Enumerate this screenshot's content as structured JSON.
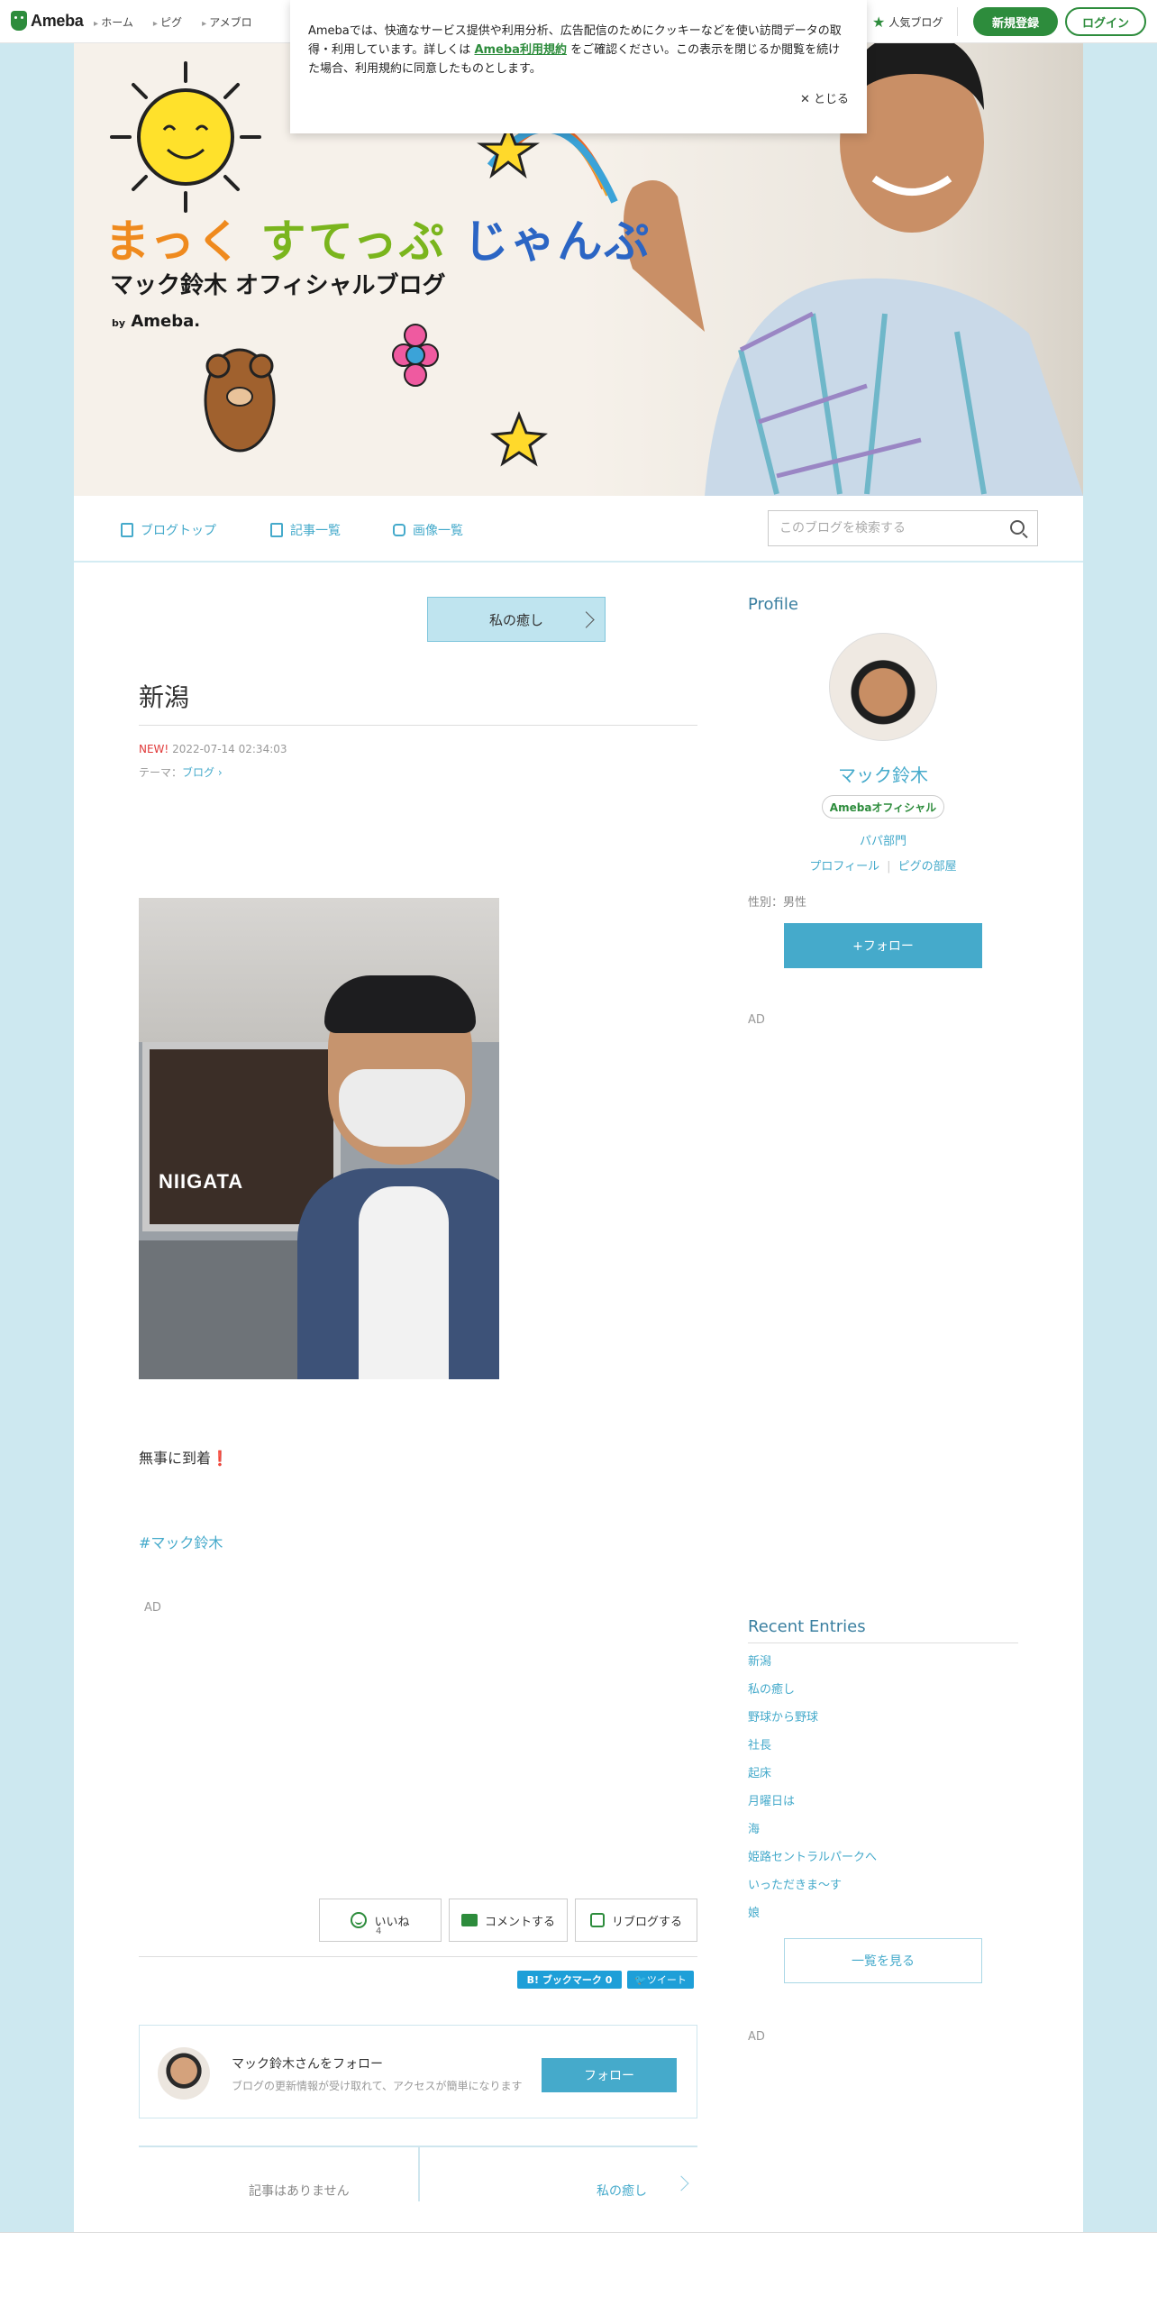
{
  "topbar": {
    "logo": "Ameba",
    "nav": [
      "ホーム",
      "ピグ",
      "アメブロ"
    ],
    "popular": "人気ブログ",
    "register": "新規登録",
    "login": "ログイン"
  },
  "cookie": {
    "text_1": "Amebaでは、快適なサービス提供や利用分析、広告配信のためにクッキーなどを使い訪問データの取得・利用しています。詳しくは",
    "link": "Ameba利用規約",
    "text_2": "をご確認ください。この表示を閉じるか閲覧を続けた場合、利用規約に同意したものとします。",
    "close": "とじる"
  },
  "header": {
    "title_part1": "まっく",
    "title_part2": "すてっぷ",
    "title_part3": "じゃんぷ",
    "subtitle": "マック鈴木 オフィシャルブログ",
    "by": "by",
    "brand": "Ameba."
  },
  "blognav": {
    "top": "ブログトップ",
    "entries": "記事一覧",
    "images": "画像一覧",
    "search_placeholder": "このブログを検索する"
  },
  "post": {
    "theme_pill": "私の癒し",
    "title": "新潟",
    "new_label": "NEW!",
    "datetime": "2022-07-14 02:34:03",
    "theme_prefix": "テーマ：",
    "theme": "ブログ",
    "photo_text": "NIIGATA",
    "body": "無事に到着",
    "body_mark": "❗",
    "hashtag": "#マック鈴木",
    "ad": "AD",
    "iine": "いいね",
    "iine_count": "4",
    "comment": "コメントする",
    "reblog": "リブログする",
    "bookmark": "B! ブックマーク 0",
    "tweet": "ツイート"
  },
  "follow_card": {
    "name": "マック鈴木さんをフォロー",
    "desc": "ブログの更新情報が受け取れて、アクセスが簡単になります",
    "button": "フォロー"
  },
  "pager": {
    "prev": "記事はありません",
    "next": "私の癒し"
  },
  "sidebar": {
    "profile_heading": "Profile",
    "name": "マック鈴木",
    "badge": "Amebaオフィシャル",
    "category": "パパ部門",
    "link_profile": "プロフィール",
    "link_pig": "ピグの部屋",
    "gender": "性別：男性",
    "follow": "+フォロー",
    "ad": "AD",
    "recent_heading": "Recent Entries",
    "recent": [
      "新潟",
      "私の癒し",
      "野球から野球",
      "社長",
      "起床",
      "月曜日は",
      "海",
      "姫路セントラルパークへ",
      "いっただきま〜す",
      "娘"
    ],
    "see_all": "一覧を見る"
  }
}
